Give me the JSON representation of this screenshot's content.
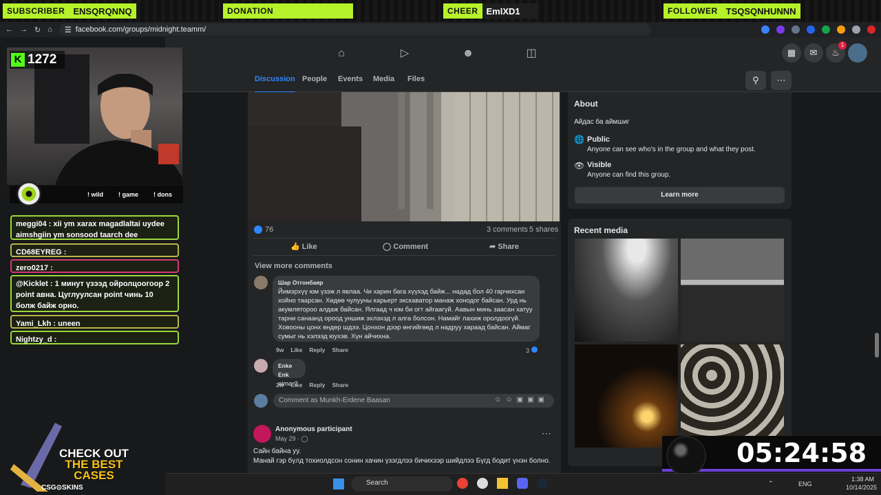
{
  "stream": {
    "alerts": [
      {
        "tag": "SUBSCRIBER",
        "value": "ENSQRQNNQ"
      },
      {
        "tag": "DONATION",
        "value": ""
      },
      {
        "tag": "CHEER",
        "value": "EmIXD1"
      },
      {
        "tag": "FOLLOWER",
        "value": "TSQSQNHUNNN"
      }
    ],
    "kick_count": "1272",
    "commands": [
      "! wild",
      "! game",
      "! dons"
    ],
    "timer": "05:24:58",
    "promo": {
      "line1": "CHECK OUT",
      "line2": "THE BEST",
      "line3": "CASES",
      "brand": "CSG⊙SKINS"
    }
  },
  "chat": [
    {
      "text": "meggi04 : xii ym xarax magadlaltai uydee aimshgiin ym sonsood taarch dee",
      "color": "green"
    },
    {
      "text": "CD68EYREG :",
      "color": "olive"
    },
    {
      "text": "zero0217 :",
      "color": "pink"
    },
    {
      "text": "@Kicklet : 1 минут үзээд ойролцоогоор 2 point авна. Цуглуулсан point чинь 10 болж байж орно.",
      "color": "green"
    },
    {
      "text": "Yami_Lkh : uneen",
      "color": "green"
    },
    {
      "text": "Nightzy_d :",
      "color": "green"
    }
  ],
  "browser": {
    "url": "facebook.com/groups/midnight.teamm/"
  },
  "fb": {
    "notif_count": "1",
    "tabs": [
      "Discussion",
      "People",
      "Events",
      "Media",
      "Files"
    ],
    "post": {
      "likes": "76",
      "comments": "3 comments",
      "shares": "5 shares",
      "like_label": "Like",
      "comment_label": "Comment",
      "share_label": "Share",
      "view_more": "View more comments",
      "comments_list": [
        {
          "author": "Шар Отгонбаяр",
          "text": "Йимэрхүү юм үзэж л явлаа. Чи харин бага хүүхэд байж... надад бол 40 гарчихсан хойно таарсан. Хөдөө чулууны карьерт экскаватор манаж хонодог байсан. Урд нь акумлятороо алдаж байсан. Ялгаад ч юм би огт айгаагүй. Аавын минь заасан хатуу тарни санаанд ороод уншиж эхлэхэд л алга болсон. Намайг лахиж оролдоогүй. Ховооны цонх өндөр шдээ. Цонхон дээр өнгийгөөд л надруу хараад байсан. Аймаг сумыг нь хэлээд юухэв. Хүн айчихна.",
          "age": "9w",
          "reactions": "3"
        },
        {
          "author": "Enke Enk",
          "text": "aimar2",
          "age": "2w",
          "reactions": ""
        }
      ],
      "meta_like": "Like",
      "meta_reply": "Reply",
      "meta_share": "Share",
      "comment_placeholder": "Comment as Munkh-Erdene Baasan"
    },
    "post2": {
      "author": "Anonymous participant",
      "date": "May 29 · ",
      "line1": "Сайн байна уу.",
      "line2": "Манай гэр бүлд тохиолдсон сонин хачин үзэгдлээ бичихээр шийдлээ Бүгд бодит үнэн болно."
    },
    "about": {
      "title": "About",
      "desc": "Айдас ба аймшиг",
      "public_title": "Public",
      "public_sub": "Anyone can see who's in the group and what they post.",
      "visible_title": "Visible",
      "visible_sub": "Anyone can find this group.",
      "learn_more": "Learn more"
    },
    "recent_media_title": "Recent media"
  },
  "taskbar": {
    "search": "Search",
    "lang": "ENG",
    "time": "1:38 AM",
    "date": "10/14/2025"
  }
}
